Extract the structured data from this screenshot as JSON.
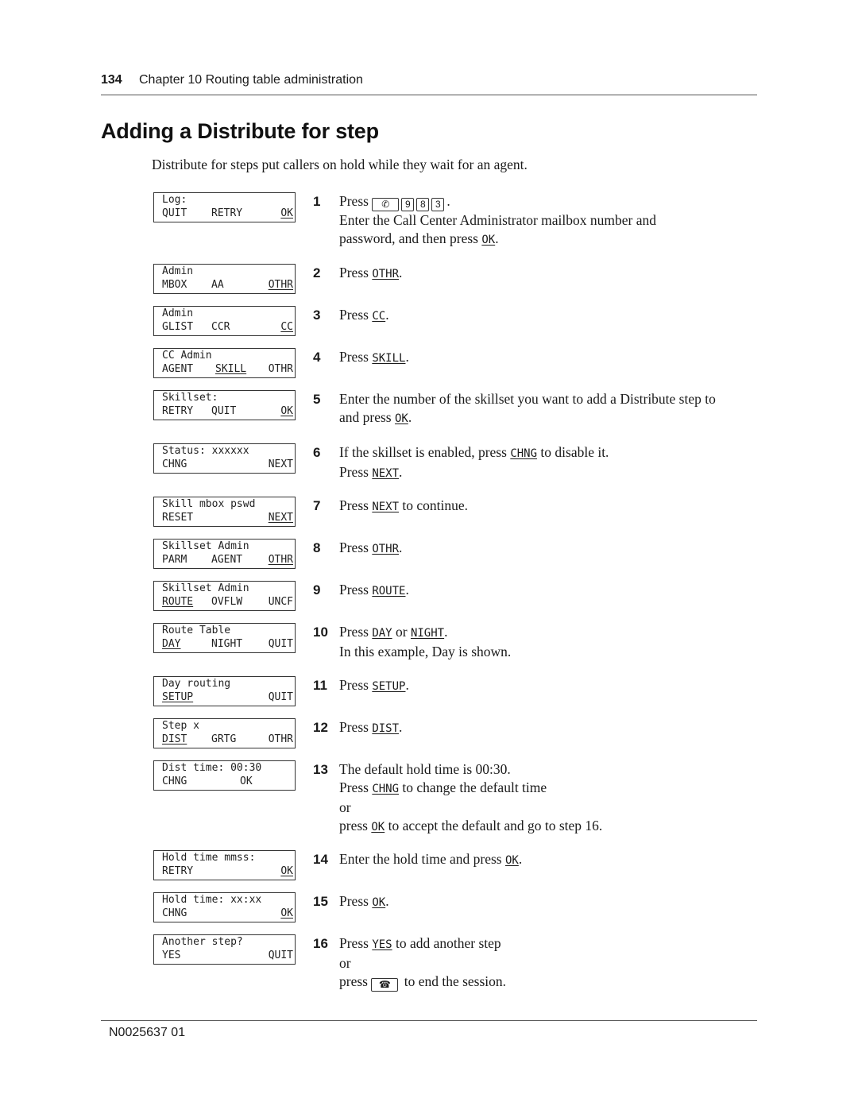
{
  "header": {
    "page_number": "134",
    "chapter": "Chapter 10  Routing table administration"
  },
  "title": "Adding a Distribute for step",
  "intro": "Distribute for steps put callers on hold while they wait for an agent.",
  "displays": [
    {
      "line1": "Log:",
      "softkeys": [
        {
          "label": "QUIT",
          "underlined": false
        },
        {
          "label": "RETRY",
          "underlined": false
        },
        {
          "label": "OK",
          "underlined": true
        }
      ]
    },
    {
      "line1": "Admin",
      "softkeys": [
        {
          "label": "MBOX",
          "underlined": false
        },
        {
          "label": "AA",
          "underlined": false
        },
        {
          "label": "OTHR",
          "underlined": true
        }
      ]
    },
    {
      "line1": "Admin",
      "softkeys": [
        {
          "label": "GLIST",
          "underlined": false
        },
        {
          "label": "CCR",
          "underlined": false
        },
        {
          "label": "CC",
          "underlined": true
        }
      ]
    },
    {
      "line1": "CC Admin",
      "softkeys": [
        {
          "label": "AGENT",
          "underlined": false
        },
        {
          "label": "SKILL",
          "underlined": true
        },
        {
          "label": "OTHR",
          "underlined": false
        }
      ]
    },
    {
      "line1": "Skillset:",
      "softkeys": [
        {
          "label": "RETRY",
          "underlined": false
        },
        {
          "label": "QUIT",
          "underlined": false
        },
        {
          "label": "OK",
          "underlined": true
        }
      ]
    },
    {
      "line1": "Status: xxxxxx",
      "softkeys": [
        {
          "label": "CHNG",
          "underlined": false
        },
        {
          "label": "",
          "underlined": false
        },
        {
          "label": "NEXT",
          "underlined": false
        }
      ]
    },
    {
      "line1": "Skill mbox pswd",
      "softkeys": [
        {
          "label": "RESET",
          "underlined": false
        },
        {
          "label": "",
          "underlined": false
        },
        {
          "label": "NEXT",
          "underlined": true
        }
      ]
    },
    {
      "line1": "Skillset Admin",
      "softkeys": [
        {
          "label": "PARM",
          "underlined": false
        },
        {
          "label": "AGENT",
          "underlined": false
        },
        {
          "label": "OTHR",
          "underlined": true
        }
      ]
    },
    {
      "line1": "Skillset Admin",
      "softkeys": [
        {
          "label": "ROUTE",
          "underlined": true
        },
        {
          "label": "OVFLW",
          "underlined": false
        },
        {
          "label": "UNCF",
          "underlined": false
        }
      ]
    },
    {
      "line1": "Route Table",
      "softkeys": [
        {
          "label": "DAY",
          "underlined": true
        },
        {
          "label": "NIGHT",
          "underlined": false
        },
        {
          "label": "QUIT",
          "underlined": false
        }
      ]
    },
    {
      "line1": "Day routing",
      "softkeys": [
        {
          "label": "SETUP",
          "underlined": true
        },
        {
          "label": "",
          "underlined": false
        },
        {
          "label": "QUIT",
          "underlined": false
        }
      ]
    },
    {
      "line1": "Step x",
      "softkeys": [
        {
          "label": "DIST",
          "underlined": true
        },
        {
          "label": "GRTG",
          "underlined": false
        },
        {
          "label": "OTHR",
          "underlined": false
        }
      ]
    },
    {
      "line1": "Dist time: 00:30",
      "softkeys": [
        {
          "label": "CHNG",
          "underlined": false
        },
        {
          "label": "OK",
          "underlined": false
        },
        {
          "label": "",
          "underlined": false
        }
      ]
    },
    {
      "line1": "Hold time mmss:",
      "softkeys": [
        {
          "label": "RETRY",
          "underlined": false
        },
        {
          "label": "",
          "underlined": false
        },
        {
          "label": "OK",
          "underlined": true
        }
      ]
    },
    {
      "line1": "Hold time: xx:xx",
      "softkeys": [
        {
          "label": "CHNG",
          "underlined": false
        },
        {
          "label": "",
          "underlined": false
        },
        {
          "label": "OK",
          "underlined": true
        }
      ]
    },
    {
      "line1": "Another step?",
      "softkeys": [
        {
          "label": "YES",
          "underlined": false
        },
        {
          "label": "",
          "underlined": false
        },
        {
          "label": "QUIT",
          "underlined": false
        }
      ]
    }
  ],
  "steps": [
    {
      "num": "1",
      "lines": [
        [
          {
            "t": "text",
            "v": "Press "
          },
          {
            "t": "key",
            "v": "feature-key",
            "icon": "✆"
          },
          {
            "t": "key",
            "v": "9"
          },
          {
            "t": "key",
            "v": "8"
          },
          {
            "t": "key",
            "v": "3"
          },
          {
            "t": "text",
            "v": "."
          }
        ],
        [
          {
            "t": "text",
            "v": "Enter the Call Center Administrator mailbox number and"
          }
        ],
        [
          {
            "t": "text",
            "v": "password, and then press "
          },
          {
            "t": "kw",
            "v": "OK"
          },
          {
            "t": "text",
            "v": "."
          }
        ]
      ]
    },
    {
      "num": "2",
      "lines": [
        [
          {
            "t": "text",
            "v": "Press "
          },
          {
            "t": "kw",
            "v": "OTHR"
          },
          {
            "t": "text",
            "v": "."
          }
        ]
      ]
    },
    {
      "num": "3",
      "lines": [
        [
          {
            "t": "text",
            "v": "Press "
          },
          {
            "t": "kw",
            "v": "CC"
          },
          {
            "t": "text",
            "v": "."
          }
        ]
      ]
    },
    {
      "num": "4",
      "lines": [
        [
          {
            "t": "text",
            "v": "Press "
          },
          {
            "t": "kw",
            "v": "SKILL"
          },
          {
            "t": "text",
            "v": "."
          }
        ]
      ]
    },
    {
      "num": "5",
      "lines": [
        [
          {
            "t": "text",
            "v": "Enter the number of the skillset you want to add a Distribute step to"
          }
        ],
        [
          {
            "t": "text",
            "v": "and press "
          },
          {
            "t": "kw",
            "v": "OK"
          },
          {
            "t": "text",
            "v": "."
          }
        ]
      ]
    },
    {
      "num": "6",
      "lines": [
        [
          {
            "t": "text",
            "v": "If the skillset is enabled, press "
          },
          {
            "t": "kw",
            "v": "CHNG"
          },
          {
            "t": "text",
            "v": " to disable it."
          }
        ],
        [
          {
            "t": "text",
            "v": "Press "
          },
          {
            "t": "kw",
            "v": "NEXT"
          },
          {
            "t": "text",
            "v": "."
          }
        ]
      ]
    },
    {
      "num": "7",
      "lines": [
        [
          {
            "t": "text",
            "v": "Press "
          },
          {
            "t": "kw",
            "v": "NEXT"
          },
          {
            "t": "text",
            "v": " to continue."
          }
        ]
      ]
    },
    {
      "num": "8",
      "lines": [
        [
          {
            "t": "text",
            "v": "Press "
          },
          {
            "t": "kw",
            "v": "OTHR"
          },
          {
            "t": "text",
            "v": "."
          }
        ]
      ]
    },
    {
      "num": "9",
      "lines": [
        [
          {
            "t": "text",
            "v": "Press "
          },
          {
            "t": "kw",
            "v": "ROUTE"
          },
          {
            "t": "text",
            "v": "."
          }
        ]
      ]
    },
    {
      "num": "10",
      "lines": [
        [
          {
            "t": "text",
            "v": "Press "
          },
          {
            "t": "kw",
            "v": "DAY"
          },
          {
            "t": "text",
            "v": " or "
          },
          {
            "t": "kw",
            "v": "NIGHT"
          },
          {
            "t": "text",
            "v": "."
          }
        ],
        [
          {
            "t": "text",
            "v": "In this example, Day is shown."
          }
        ]
      ]
    },
    {
      "num": "11",
      "lines": [
        [
          {
            "t": "text",
            "v": "Press "
          },
          {
            "t": "kw",
            "v": "SETUP"
          },
          {
            "t": "text",
            "v": "."
          }
        ]
      ]
    },
    {
      "num": "12",
      "lines": [
        [
          {
            "t": "text",
            "v": "Press "
          },
          {
            "t": "kw",
            "v": "DIST"
          },
          {
            "t": "text",
            "v": "."
          }
        ]
      ]
    },
    {
      "num": "13",
      "lines": [
        [
          {
            "t": "text",
            "v": "The default hold time is 00:30."
          }
        ],
        [
          {
            "t": "text",
            "v": "Press "
          },
          {
            "t": "kw",
            "v": "CHNG"
          },
          {
            "t": "text",
            "v": " to change the default time"
          }
        ],
        [
          {
            "t": "text",
            "v": "or"
          }
        ],
        [
          {
            "t": "text",
            "v": "press "
          },
          {
            "t": "kw",
            "v": "OK"
          },
          {
            "t": "text",
            "v": " to accept the default and go to step 16."
          }
        ]
      ]
    },
    {
      "num": "14",
      "lines": [
        [
          {
            "t": "text",
            "v": "Enter the hold time and press "
          },
          {
            "t": "kw",
            "v": "OK"
          },
          {
            "t": "text",
            "v": "."
          }
        ]
      ]
    },
    {
      "num": "15",
      "lines": [
        [
          {
            "t": "text",
            "v": "Press "
          },
          {
            "t": "kw",
            "v": "OK"
          },
          {
            "t": "text",
            "v": "."
          }
        ]
      ]
    },
    {
      "num": "16",
      "lines": [
        [
          {
            "t": "text",
            "v": "Press "
          },
          {
            "t": "kw",
            "v": "YES"
          },
          {
            "t": "text",
            "v": " to add another step"
          }
        ],
        [
          {
            "t": "text",
            "v": "or"
          }
        ],
        [
          {
            "t": "text",
            "v": "press "
          },
          {
            "t": "key",
            "v": "release-key",
            "icon": "☎"
          },
          {
            "t": "text",
            "v": " to end the session."
          }
        ]
      ]
    }
  ],
  "footer": {
    "doc_id": "N0025637 01"
  }
}
